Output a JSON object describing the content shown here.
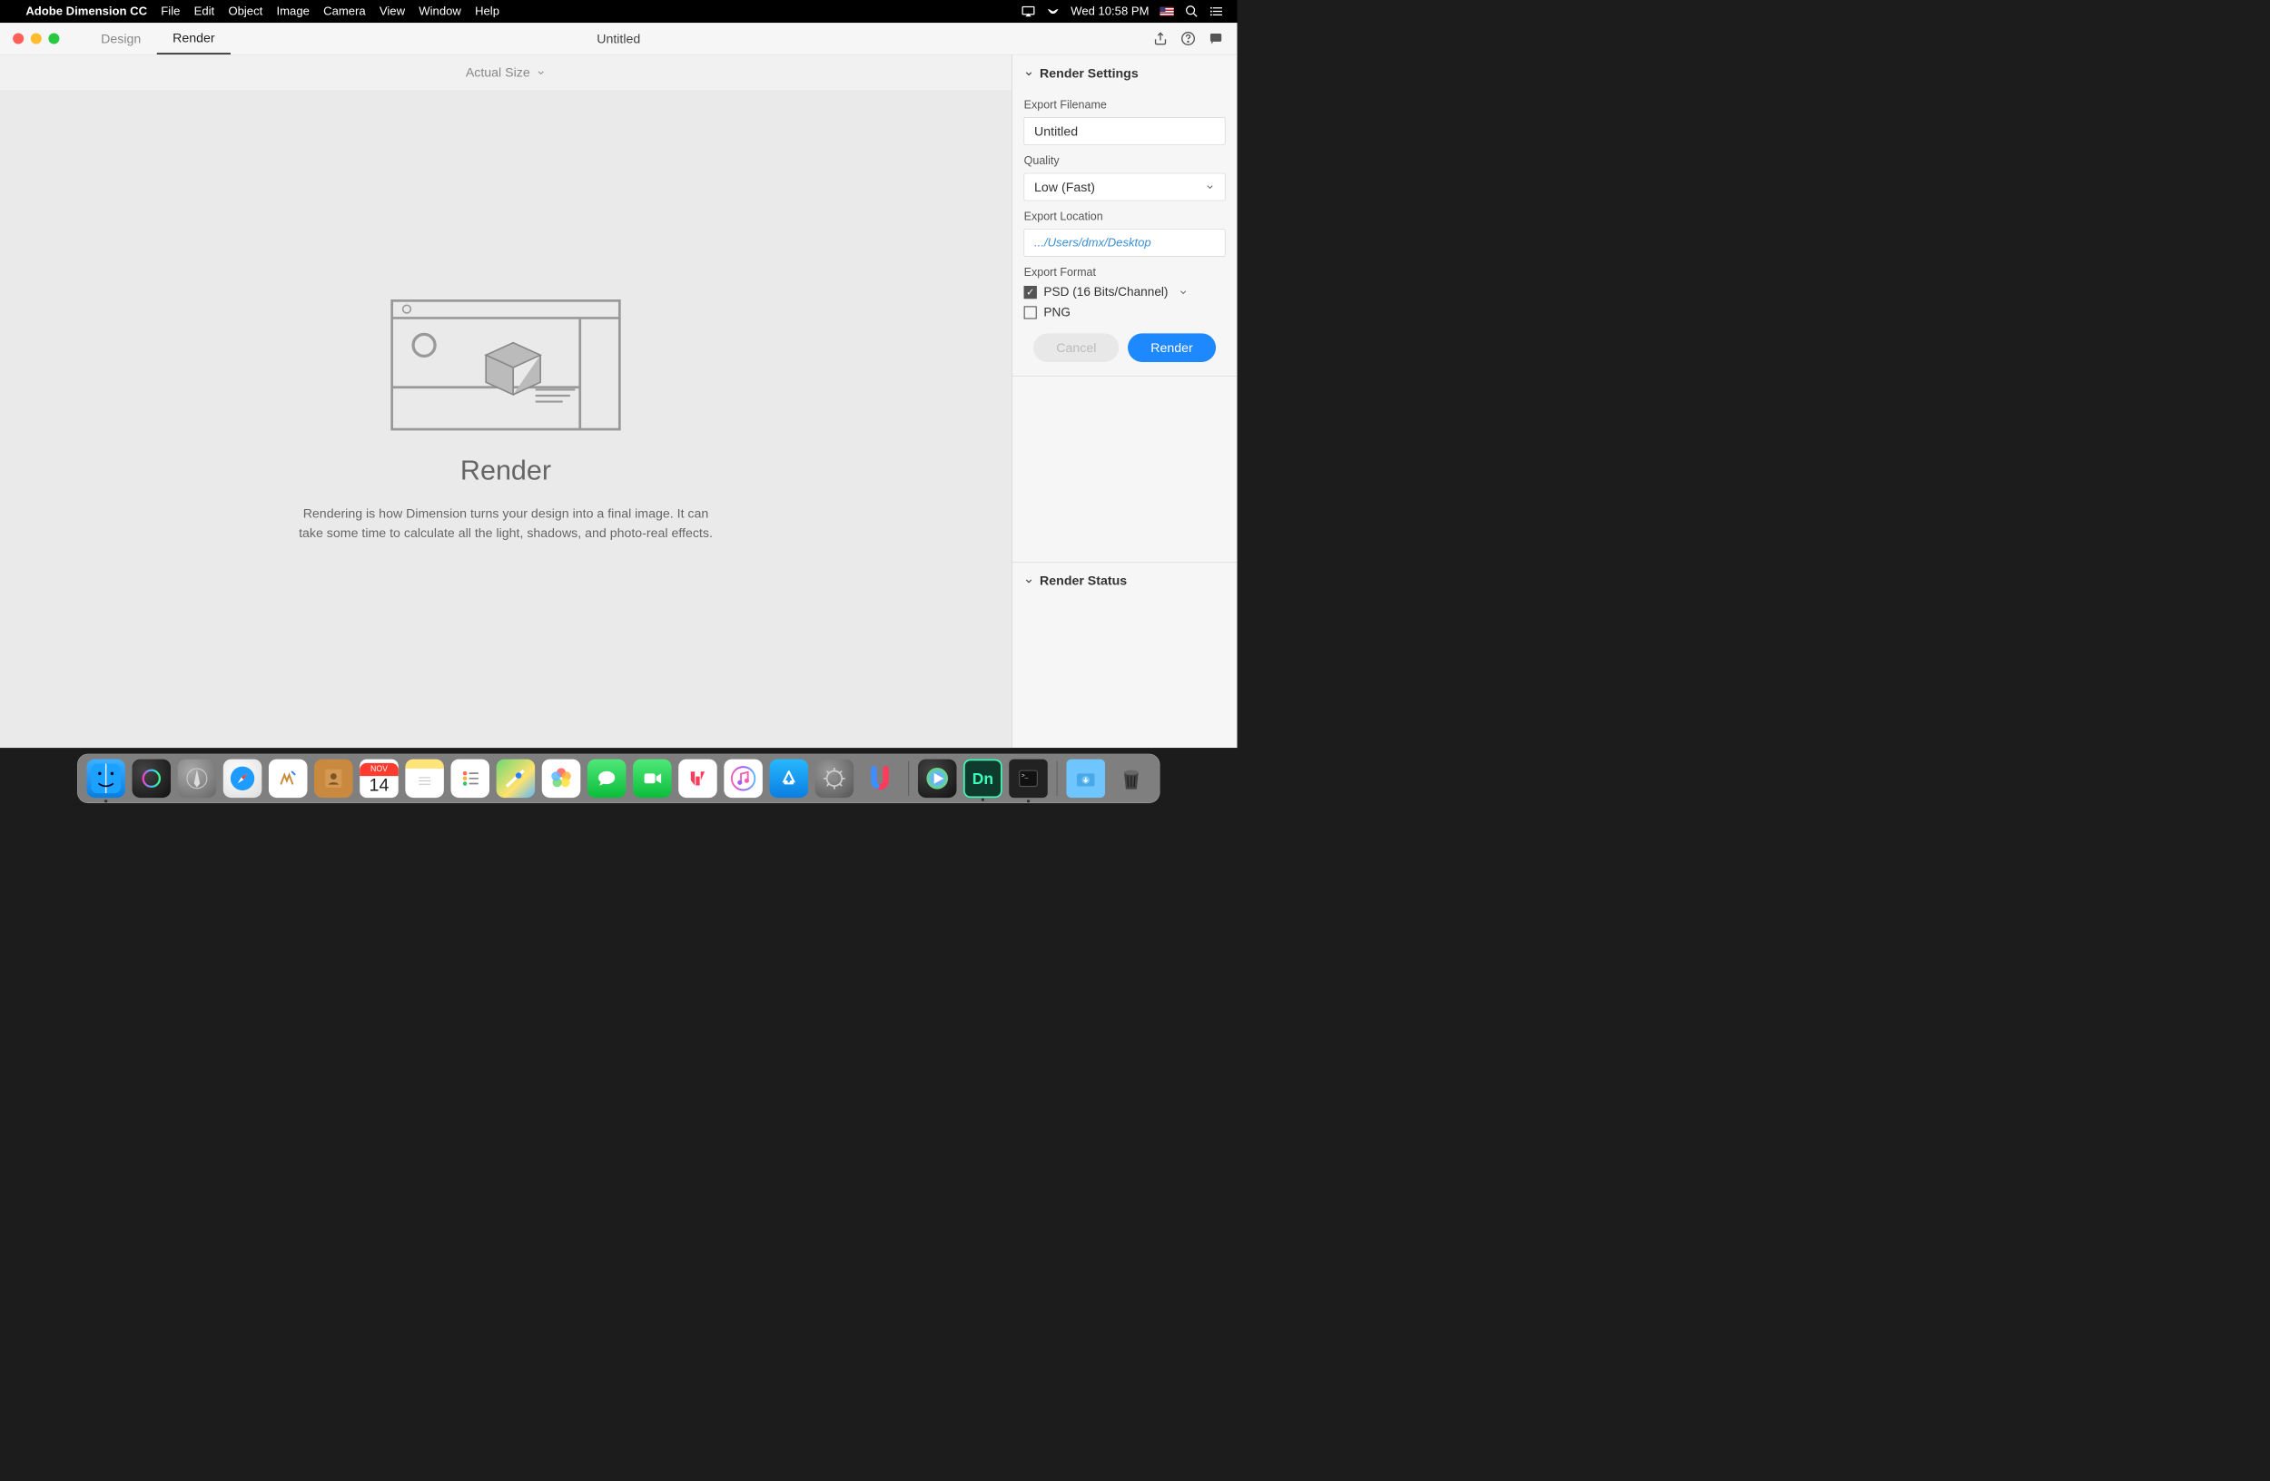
{
  "menubar": {
    "app_name": "Adobe Dimension CC",
    "menus": [
      "File",
      "Edit",
      "Object",
      "Image",
      "Camera",
      "View",
      "Window",
      "Help"
    ],
    "clock": "Wed 10:58 PM"
  },
  "window": {
    "tabs": {
      "design": "Design",
      "render": "Render"
    },
    "title": "Untitled"
  },
  "canvas": {
    "zoom_label": "Actual Size",
    "placeholder_title": "Render",
    "placeholder_desc": "Rendering is how Dimension turns your design into a final image. It can take some time to calculate all the light, shadows, and photo-real effects."
  },
  "panel": {
    "settings_header": "Render Settings",
    "status_header": "Render Status",
    "filename_label": "Export Filename",
    "filename_value": "Untitled",
    "quality_label": "Quality",
    "quality_value": "Low (Fast)",
    "location_label": "Export Location",
    "location_value": ".../Users/dmx/Desktop",
    "format_label": "Export Format",
    "format_psd": "PSD (16 Bits/Channel)",
    "format_png": "PNG",
    "cancel": "Cancel",
    "render": "Render"
  },
  "dock": {
    "calendar_month": "NOV",
    "calendar_day": "14"
  }
}
